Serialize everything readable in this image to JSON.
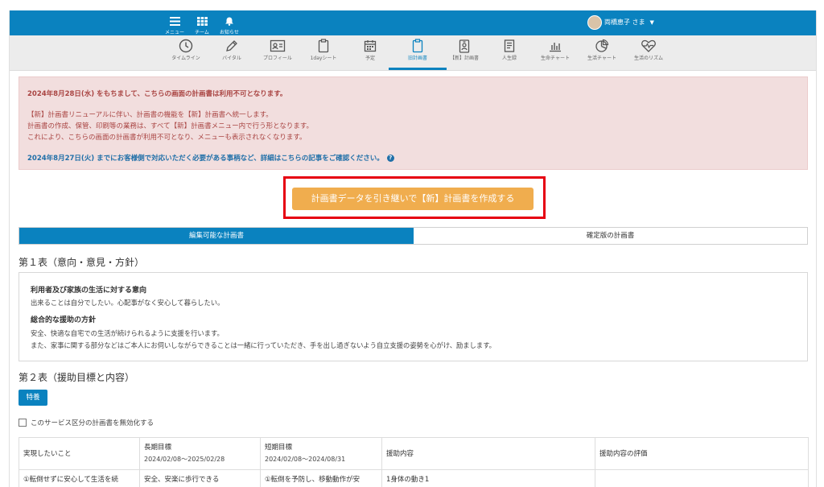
{
  "topnav": {
    "menu_label": "メニュー",
    "team_label": "チーム",
    "notice_label": "お知らせ",
    "user_name": "両橋恵子 さま"
  },
  "tabs": [
    {
      "label": "タイムライン",
      "icon": "clock-icon"
    },
    {
      "label": "バイタル",
      "icon": "pen-icon"
    },
    {
      "label": "プロフィール",
      "icon": "profile-card-icon"
    },
    {
      "label": "1dayシート",
      "icon": "clipboard-icon"
    },
    {
      "label": "予定",
      "icon": "calendar-icon"
    },
    {
      "label": "旧計画書",
      "icon": "clipboard-active-icon"
    },
    {
      "label": "【新】計画書",
      "icon": "id-badge-icon"
    },
    {
      "label": "人生録",
      "icon": "book-icon"
    },
    {
      "label": "生命チャート",
      "icon": "bar-chart-icon"
    },
    {
      "label": "生活チャート",
      "icon": "pie-chart-icon"
    },
    {
      "label": "生活のリズム",
      "icon": "heartbeat-icon"
    }
  ],
  "alert": {
    "line1": "2024年8月28日(水) をもちまして、こちらの画面の計画書は利用不可となります。",
    "line2": "【新】計画書リニューアルに伴い、計画書の機能を【新】計画書へ統一します。",
    "line3": "計画書の作成、保管、印刷等の業務は、すべて【新】計画書メニュー内で行う形となります。",
    "line4": "これにより、こちらの画面の計画書が利用不可となり、メニューも表示されなくなります。",
    "line5": "2024年8月27日(火) までにお客様側で対応いただく必要がある事柄など、詳細はこちらの記事をご確認ください。",
    "help": "?"
  },
  "cta": {
    "label": "計画書データを引き継いで【新】計画書を作成する"
  },
  "segments": {
    "editable": "編集可能な計画書",
    "fixed": "確定版の計画書"
  },
  "table1": {
    "title": "第１表（意向・意見・方針）",
    "intent_title": "利用者及び家族の生活に対する意向",
    "intent_text": "出来ることは自分でしたい。心配事がなく安心して暮らしたい。",
    "policy_title": "総合的な援助の方針",
    "policy_text1": "安全、快適な自宅での生活が続けられるように支援を行います。",
    "policy_text2": "また、家事に関する部分などはご本人にお伺いしながらできることは一緒に行っていただき、手を出し過ぎないよう自立支援の姿勢を心がけ、励まします。"
  },
  "table2": {
    "title": "第２表（援助目標と内容）",
    "special_button": "特養",
    "disable_checkbox": "このサービス区分の計画書を無効化する",
    "headers": {
      "want": "実現したいこと",
      "long_goal": "長期目標",
      "long_period": "2024/02/08～2025/02/28",
      "short_goal": "短期目標",
      "short_period": "2024/02/08～2024/08/31",
      "content": "援助内容",
      "evaluation": "援助内容の評価"
    },
    "row1": {
      "want": "①転倒せずに安心して生活を続",
      "long_goal": "安全、安楽に歩行できる",
      "short_goal": "①転倒を予防し、移動動作が安",
      "content": "1身体の動き1"
    }
  }
}
